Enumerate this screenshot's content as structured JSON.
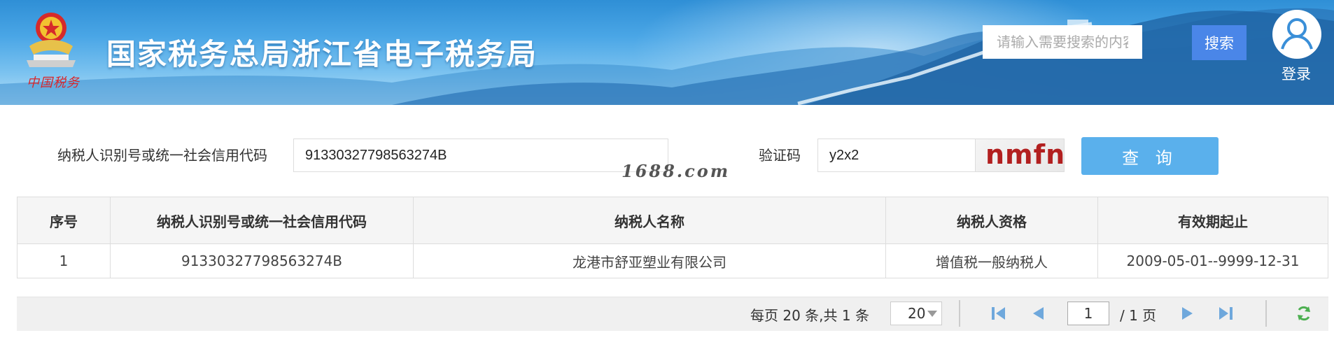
{
  "header": {
    "site_title": "国家税务总局浙江省电子税务局",
    "emblem_signature": "中国税务",
    "search_placeholder": "请输入需要搜索的内容",
    "search_button": "搜索",
    "login_label": "登录"
  },
  "query": {
    "taxpayer_id_label": "纳税人识别号或统一社会信用代码",
    "taxpayer_id_value": "91330327798563274B",
    "captcha_label": "验证码",
    "captcha_value": "y2x2",
    "captcha_image_text": "nmfn",
    "query_button": "查 询",
    "watermark": "1688.com"
  },
  "table": {
    "headers": [
      "序号",
      "纳税人识别号或统一社会信用代码",
      "纳税人名称",
      "纳税人资格",
      "有效期起止"
    ],
    "rows": [
      [
        "1",
        "91330327798563274B",
        "龙港市舒亚塑业有限公司",
        "增值税一般纳税人",
        "2009-05-01--9999-12-31"
      ]
    ]
  },
  "pager": {
    "summary": "每页 20 条,共 1 条",
    "page_size": "20",
    "current_page": "1",
    "total_pages": "/ 1 页"
  },
  "colors": {
    "search_button": "#4a86e8",
    "query_button": "#5ab0ec",
    "captcha_text": "#b21f1f",
    "pager_icons": "#6fa8dc",
    "refresh_icon": "#4caf50"
  }
}
